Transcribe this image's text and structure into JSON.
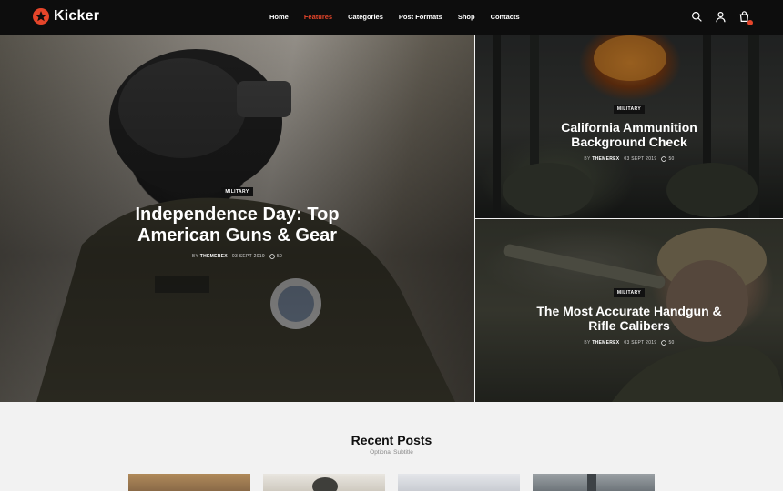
{
  "header": {
    "logo_text": "Kicker",
    "nav": [
      {
        "label": "Home",
        "active": false
      },
      {
        "label": "Features",
        "active": true
      },
      {
        "label": "Categories",
        "active": false
      },
      {
        "label": "Post Formats",
        "active": false
      },
      {
        "label": "Shop",
        "active": false
      },
      {
        "label": "Contacts",
        "active": false
      }
    ],
    "icons": [
      "search-icon",
      "user-icon",
      "cart-icon"
    ],
    "accent_color": "#e5452a"
  },
  "hero": {
    "main": {
      "badge": "Military",
      "title_line1": "Independence Day: Top",
      "title_line2": "American Guns & Gear",
      "by": "BY",
      "author": "THEMEREX",
      "date": "03 SEPT 2019",
      "comments": "50"
    },
    "top_right": {
      "badge": "Military",
      "title_line1": "California Ammunition",
      "title_line2": "Background Check",
      "by": "BY",
      "author": "THEMEREX",
      "date": "03 SEPT 2019",
      "comments": "50"
    },
    "bottom_right": {
      "badge": "Military",
      "title_line1": "The Most Accurate Handgun &",
      "title_line2": "Rifle Calibers",
      "by": "BY",
      "author": "THEMEREX",
      "date": "03 SEPT 2019",
      "comments": "50"
    }
  },
  "recent_posts": {
    "title": "Recent Posts",
    "subtitle": "Optional Subtitle"
  }
}
